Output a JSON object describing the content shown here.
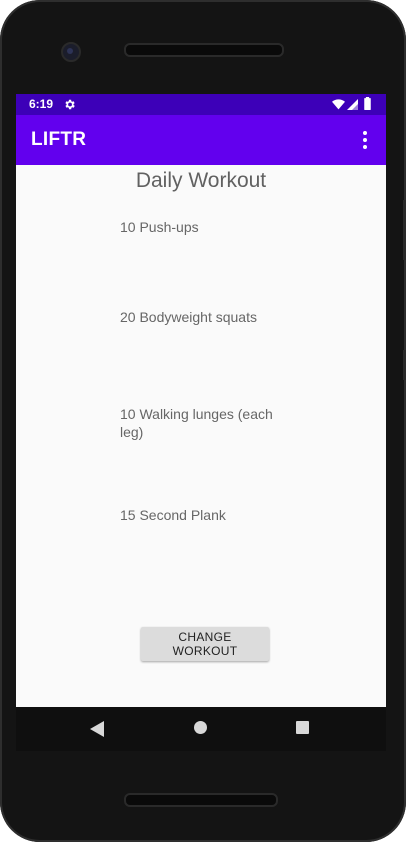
{
  "status_bar": {
    "time": "6:19",
    "icons": [
      "gear-icon",
      "wifi-icon",
      "signal-icon",
      "battery-icon"
    ],
    "color": "#3d00b8"
  },
  "app_bar": {
    "title": "LIFTR",
    "color": "#6200ee",
    "menu_icon": "overflow-menu-icon"
  },
  "main": {
    "title": "Daily Workout",
    "exercises": [
      "10 Push-ups",
      "20 Bodyweight squats",
      "10 Walking lunges (each leg)",
      "15 Second Plank"
    ],
    "button_label": "CHANGE WORKOUT"
  },
  "nav_bar": {
    "icons": [
      "back-icon",
      "home-icon",
      "recents-icon"
    ]
  }
}
